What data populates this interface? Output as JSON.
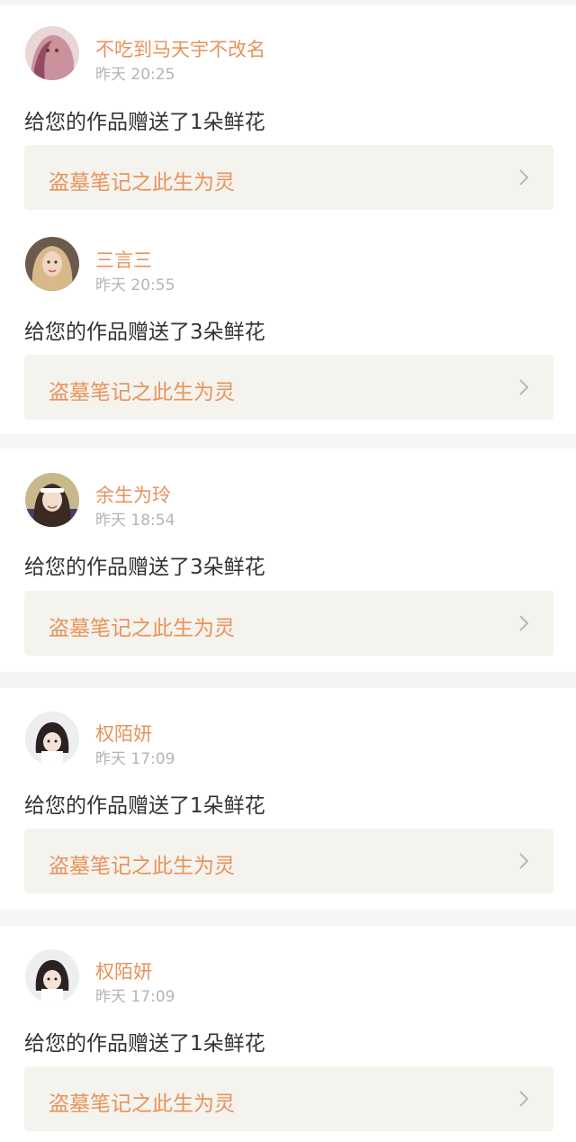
{
  "notifications": [
    {
      "username": "不吃到马天宇不改名",
      "time": "昨天 20:25",
      "message": "给您的作品赠送了1朵鲜花",
      "work_title": "盗墓笔记之此生为灵",
      "avatar_icon": "avatar-girl-pink-hair-icon"
    },
    {
      "username": "三言三",
      "time": "昨天 20:55",
      "message": "给您的作品赠送了3朵鲜花",
      "work_title": "盗墓笔记之此生为灵",
      "avatar_icon": "avatar-blonde-woman-icon"
    },
    {
      "username": "余生为玲",
      "time": "昨天 18:54",
      "message": "给您的作品赠送了3朵鲜花",
      "work_title": "盗墓笔记之此生为灵",
      "avatar_icon": "avatar-girl-headband-icon"
    },
    {
      "username": "权陌妍",
      "time": "昨天 17:09",
      "message": "给您的作品赠送了1朵鲜花",
      "work_title": "盗墓笔记之此生为灵",
      "avatar_icon": "avatar-girl-dark-hair-icon"
    },
    {
      "username": "权陌妍",
      "time": "昨天 17:09",
      "message": "给您的作品赠送了1朵鲜花",
      "work_title": "盗墓笔记之此生为灵",
      "avatar_icon": "avatar-girl-dark-hair-icon"
    }
  ],
  "colors": {
    "accent": "#e8935a",
    "message_text": "#333333",
    "muted_text": "#b4b4b4",
    "card_link_bg": "#f4f3ee",
    "separator_bg": "#f5f5f5"
  }
}
